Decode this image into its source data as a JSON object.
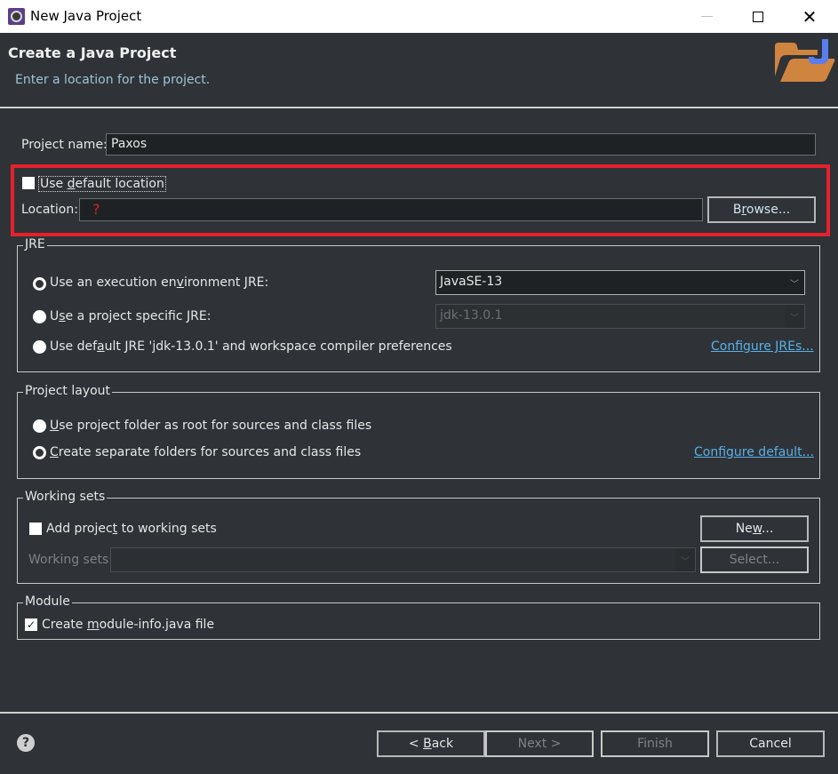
{
  "window": {
    "title": "New Java Project",
    "icon": "eclipse-icon",
    "controls": {
      "minimize": "minimize-icon",
      "maximize": "maximize-icon",
      "close": "close-icon",
      "close_glyph": "✕"
    }
  },
  "header": {
    "title": "Create a Java Project",
    "description": "Enter a location for the project.",
    "icon": "java-project-folder-icon"
  },
  "form": {
    "project_name": {
      "label": "Project name:",
      "value": "Paxos"
    },
    "use_default_location": {
      "label": "Use default location",
      "mnemonic": "d",
      "checked": false
    },
    "location": {
      "label": "Location:",
      "value": "?"
    },
    "browse_button": "Browse...",
    "highlight_color": "#e5212b"
  },
  "jre": {
    "title": "JRE",
    "options": [
      {
        "label": "Use an execution environment JRE:",
        "selected": true
      },
      {
        "label": "Use a project specific JRE:",
        "selected": false
      },
      {
        "label": "Use default JRE 'jdk-13.0.1' and workspace compiler preferences",
        "selected": false
      }
    ],
    "execution_env_value": "JavaSE-13",
    "project_jre_value": "jdk-13.0.1",
    "configure_link": "Configure JREs..."
  },
  "layout": {
    "title": "Project layout",
    "options": [
      {
        "label": "Use project folder as root for sources and class files",
        "selected": false
      },
      {
        "label": "Create separate folders for sources and class files",
        "selected": true
      }
    ],
    "configure_link": "Configure default..."
  },
  "working_sets": {
    "title": "Working sets",
    "add_label": "Add project to working sets",
    "add_checked": false,
    "sets_label": "Working sets:",
    "sets_value": "",
    "new_button": "New...",
    "select_button": "Select..."
  },
  "module": {
    "title": "Module",
    "create_label": "Create module-info.java file",
    "checked": true,
    "check_glyph": "✓"
  },
  "footer": {
    "help_glyph": "?",
    "back": "< Back",
    "next": "Next >",
    "finish": "Finish",
    "cancel": "Cancel"
  },
  "arrow_glyph": "﹀"
}
